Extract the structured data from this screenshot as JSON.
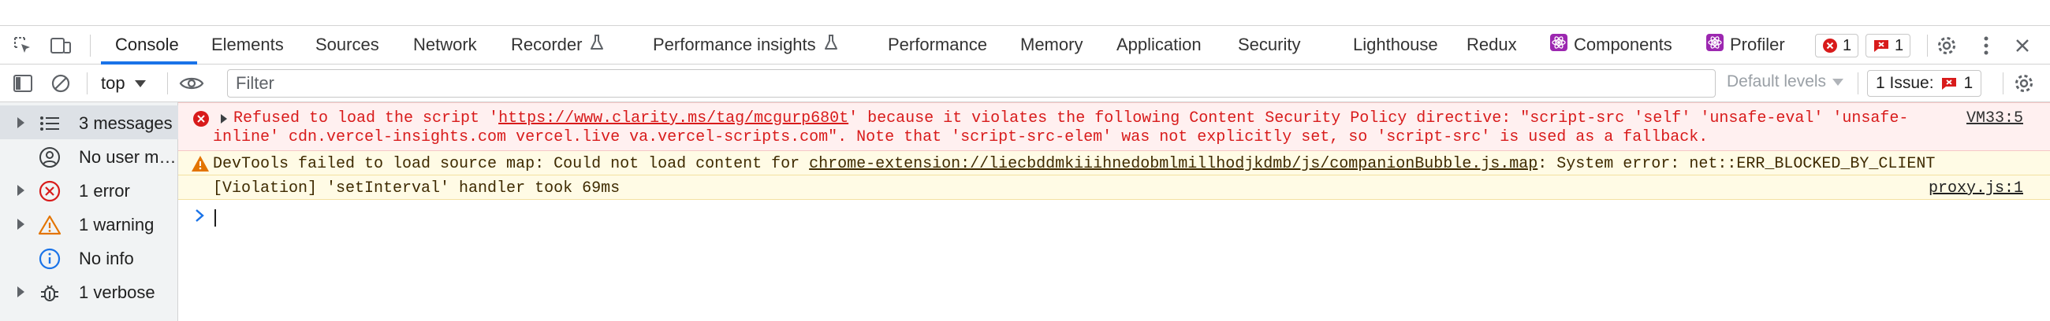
{
  "tabs": [
    {
      "label": "Console",
      "active": true
    },
    {
      "label": "Elements"
    },
    {
      "label": "Sources"
    },
    {
      "label": "Network"
    },
    {
      "label": "Recorder"
    },
    {
      "label": "Performance insights"
    },
    {
      "label": "Performance"
    },
    {
      "label": "Memory"
    },
    {
      "label": "Application"
    },
    {
      "label": "Security"
    },
    {
      "label": "Lighthouse"
    },
    {
      "label": "Redux"
    },
    {
      "label": "Components"
    },
    {
      "label": "Profiler"
    }
  ],
  "badges": {
    "errors": "1",
    "issues": "1"
  },
  "filterbar": {
    "context": "top",
    "filter_placeholder": "Filter",
    "levels": "Default levels",
    "issues_label": "1 Issue:",
    "issues_count": "1"
  },
  "sidebar": {
    "items": [
      {
        "label": "3 messages",
        "icon": "list-icon"
      },
      {
        "label": "No user m…",
        "icon": "user-icon"
      },
      {
        "label": "1 error",
        "icon": "error-icon"
      },
      {
        "label": "1 warning",
        "icon": "warning-icon"
      },
      {
        "label": "No info",
        "icon": "info-icon"
      },
      {
        "label": "1 verbose",
        "icon": "bug-icon"
      }
    ]
  },
  "console": {
    "error": {
      "pre": "Refused to load the script '",
      "url": "https://www.clarity.ms/tag/mcgurp680t",
      "post": "' because it violates the following Content Security Policy directive: \"script-src 'self' 'unsafe-eval' 'unsafe-",
      "line2": "inline' cdn.vercel-insights.com vercel.live va.vercel-scripts.com\". Note that 'script-src-elem' was not explicitly set, so 'script-src' is used as a fallback.",
      "source": "VM33:5"
    },
    "warning": {
      "pre": "DevTools failed to load source map: Could not load content for ",
      "url": "chrome-extension://liecbddmkiiihnedobmlmillhodjkdmb/js/companionBubble.js.map",
      "post": ": System error: net::ERR_BLOCKED_BY_CLIENT"
    },
    "violation": {
      "text": "[Violation] 'setInterval' handler took 69ms",
      "source": "proxy.js:1"
    }
  },
  "colors": {
    "accent": "#1a73e8",
    "error": "#d81b1b",
    "warning": "#e37400"
  }
}
